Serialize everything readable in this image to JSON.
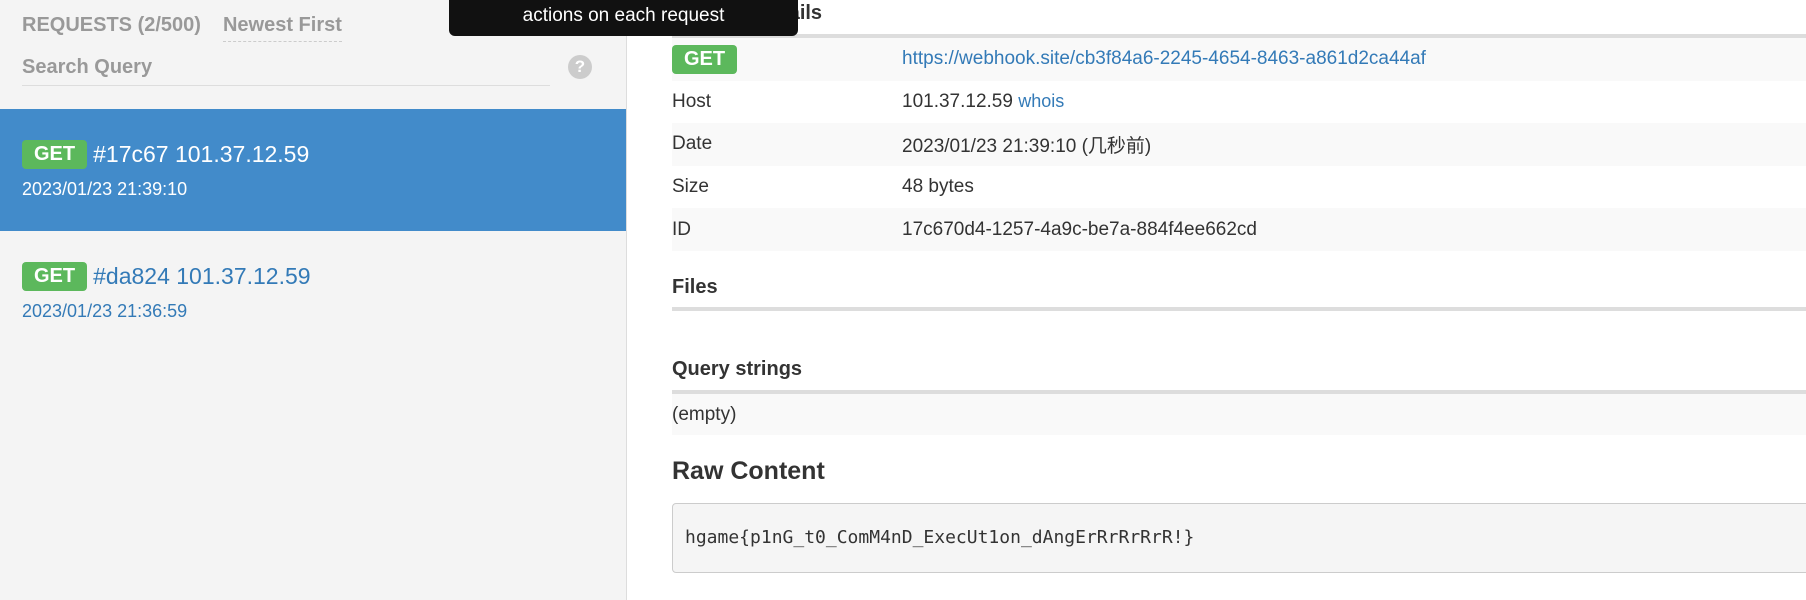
{
  "sidebar": {
    "title": "REQUESTS (2/500)",
    "sort": "Newest First",
    "search_placeholder": "Search Query",
    "help": "?",
    "items": [
      {
        "method": "GET",
        "title": "#17c67 101.37.12.59",
        "date": "2023/01/23 21:39:10"
      },
      {
        "method": "GET",
        "title": "#da824 101.37.12.59",
        "date": "2023/01/23 21:36:59"
      }
    ]
  },
  "tooltip": "actions on each request",
  "details": {
    "heading": "Request Details",
    "method": "GET",
    "url": "https://webhook.site/cb3f84a6-2245-4654-8463-a861d2ca44af",
    "host_label": "Host",
    "host": "101.37.12.59",
    "whois": "whois",
    "date_label": "Date",
    "date": "2023/01/23 21:39:10 (几秒前)",
    "size_label": "Size",
    "size": "48 bytes",
    "id_label": "ID",
    "id": "17c670d4-1257-4a9c-be7a-884f4ee662cd"
  },
  "files": {
    "heading": "Files"
  },
  "query": {
    "heading": "Query strings",
    "value": "(empty)"
  },
  "raw": {
    "heading": "Raw Content",
    "content": "hgame{p1nG_t0_ComM4nD_ExecUt1on_dAngErRrRrRrR!}"
  },
  "colors": {
    "accent": "#428bca",
    "get": "#5cb85c"
  }
}
